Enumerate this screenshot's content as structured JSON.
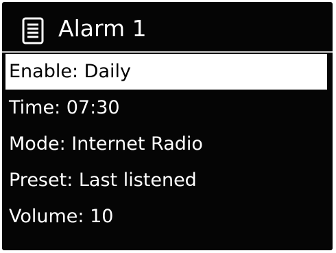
{
  "header": {
    "icon": "menu-list-icon",
    "title": "Alarm 1"
  },
  "menu": {
    "items": [
      {
        "label": "Enable: Daily",
        "selected": true
      },
      {
        "label": "Time: 07:30",
        "selected": false
      },
      {
        "label": "Mode: Internet Radio",
        "selected": false
      },
      {
        "label": "Preset: Last listened",
        "selected": false
      },
      {
        "label": "Volume: 10",
        "selected": false
      }
    ]
  },
  "colors": {
    "screen_background": "#050505",
    "text": "#ffffff",
    "highlight_background": "#ffffff",
    "highlight_text": "#000000"
  }
}
